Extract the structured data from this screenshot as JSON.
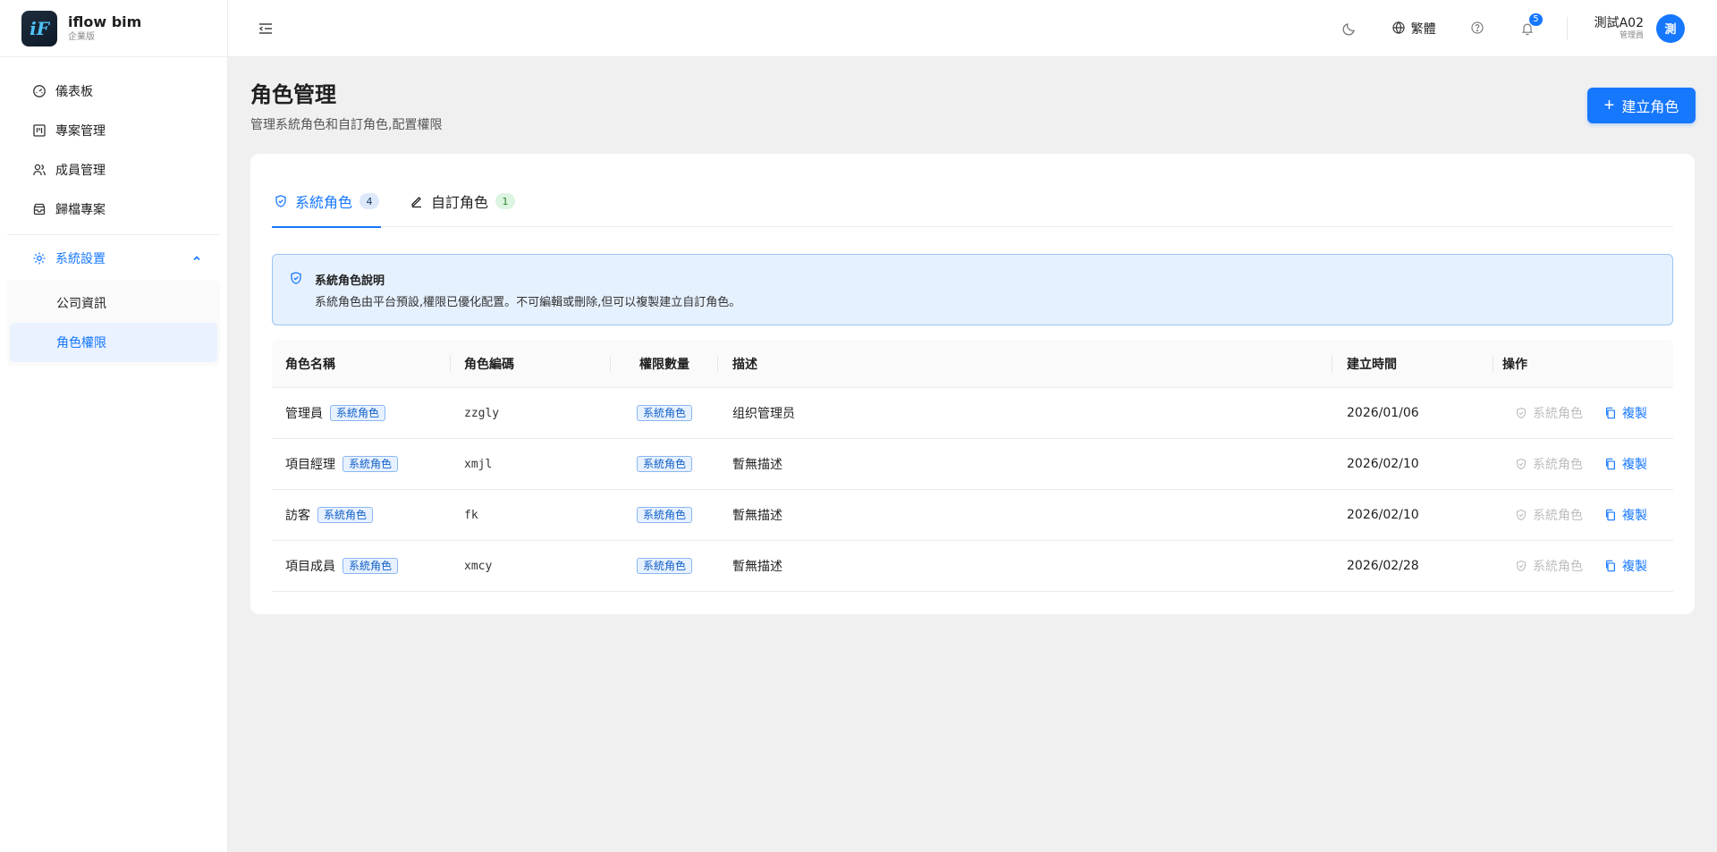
{
  "brand": {
    "logo_text": "iF",
    "name": "iflow bim",
    "edition": "企業版"
  },
  "sidebar": {
    "items": [
      {
        "label": "儀表板",
        "icon": "dashboard-gauge-icon"
      },
      {
        "label": "專案管理",
        "icon": "kanban-board-icon"
      },
      {
        "label": "成員管理",
        "icon": "users-icon"
      },
      {
        "label": "歸檔專案",
        "icon": "archive-box-icon"
      }
    ],
    "group": {
      "label": "系統設置",
      "icon": "gear-icon",
      "expanded": true,
      "children": [
        {
          "label": "公司資訊",
          "active": false
        },
        {
          "label": "角色權限",
          "active": true
        }
      ]
    }
  },
  "header": {
    "language": "繁體",
    "notification_count": "5",
    "user_name": "測試A02",
    "user_role": "管理員",
    "avatar_text": "測"
  },
  "page": {
    "title": "角色管理",
    "subtitle": "管理系統角色和自訂角色,配置權限",
    "create_button": "建立角色",
    "create_button_icon": "+"
  },
  "tabs": [
    {
      "label": "系統角色",
      "count": "4",
      "active": true,
      "icon": "shield-check-icon"
    },
    {
      "label": "自訂角色",
      "count": "1",
      "active": false,
      "icon": "pencil-edit-icon"
    }
  ],
  "alert": {
    "title": "系統角色說明",
    "body": "系統角色由平台預設,權限已優化配置。不可編輯或刪除,但可以複製建立自訂角色。"
  },
  "table": {
    "columns": [
      "角色名稱",
      "角色編碼",
      "權限數量",
      "描述",
      "建立時間",
      "操作"
    ],
    "rows": [
      {
        "name": "管理員",
        "tag": "系統角色",
        "code": "zzgly",
        "perm": "系統角色",
        "desc": "组织管理员",
        "created": "2026/01/06",
        "op_disabled": "系統角色",
        "op_copy": "複製"
      },
      {
        "name": "項目經理",
        "tag": "系統角色",
        "code": "xmjl",
        "perm": "系統角色",
        "desc": "暫無描述",
        "created": "2026/02/10",
        "op_disabled": "系統角色",
        "op_copy": "複製"
      },
      {
        "name": "訪客",
        "tag": "系統角色",
        "code": "fk",
        "perm": "系統角色",
        "desc": "暫無描述",
        "created": "2026/02/10",
        "op_disabled": "系統角色",
        "op_copy": "複製"
      },
      {
        "name": "項目成員",
        "tag": "系統角色",
        "code": "xmcy",
        "perm": "系統角色",
        "desc": "暫無描述",
        "created": "2026/02/28",
        "op_disabled": "系統角色",
        "op_copy": "複製"
      }
    ]
  },
  "colors": {
    "primary": "#1677ff",
    "page_bg": "#f0f0f0",
    "alert_bg": "#e6f1ff",
    "alert_border": "#9cc4f5",
    "tag_bg": "#e8f1ff",
    "tag_border": "#8ab7f0",
    "green_badge_bg": "#dcf5e0"
  }
}
